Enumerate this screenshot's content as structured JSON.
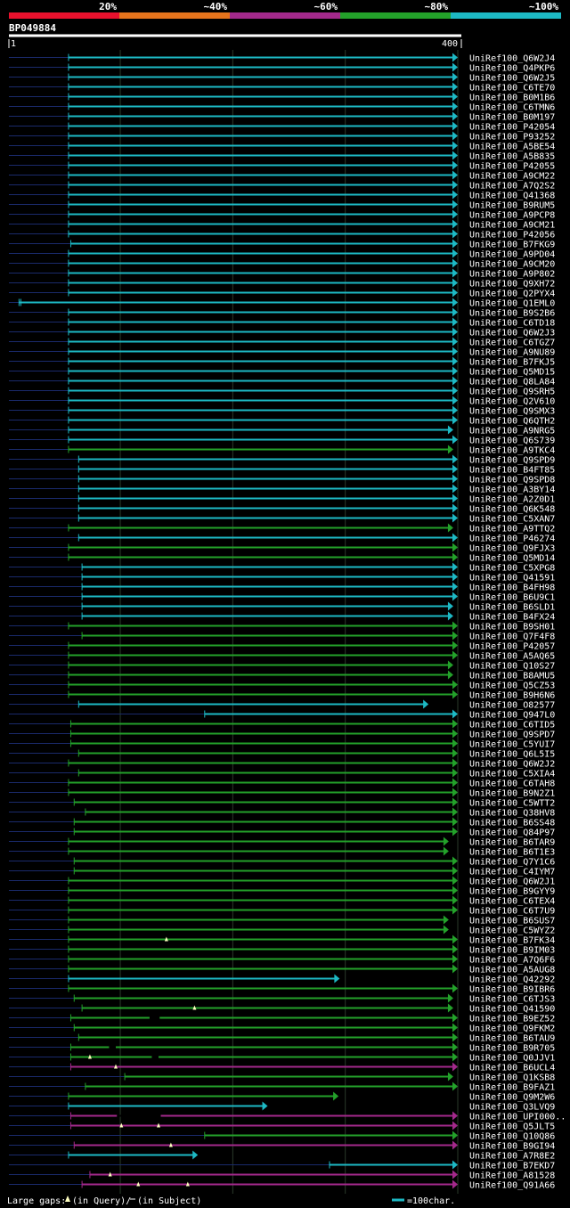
{
  "identity_bar": {
    "labels": [
      "20%",
      "~40%",
      "~60%",
      "~80%",
      "~100%"
    ],
    "colors": [
      "#e8112d",
      "#e6741c",
      "#a3298b",
      "#23a12a",
      "#1db9c4"
    ]
  },
  "query_id": "BP049884",
  "ruler": {
    "start": "1",
    "end": "400"
  },
  "legend": {
    "gaps_text": "Large gaps:",
    "query_text": "(in Query)/",
    "subject_text": "(in Subject)",
    "scale_text": "=100char."
  },
  "chart_data": {
    "type": "alignment",
    "query_length": 400,
    "xlim": [
      1,
      400
    ],
    "grid": true,
    "hits": [
      {
        "name": "UniRef100_Q6W2J4",
        "start": 54,
        "end": 400,
        "color": "cyan"
      },
      {
        "name": "UniRef100_Q4PKP6",
        "start": 54,
        "end": 400,
        "color": "cyan"
      },
      {
        "name": "UniRef100_Q6W2J5",
        "start": 54,
        "end": 400,
        "color": "cyan"
      },
      {
        "name": "UniRef100_C6TE70",
        "start": 54,
        "end": 400,
        "color": "cyan"
      },
      {
        "name": "UniRef100_B0M1B6",
        "start": 54,
        "end": 400,
        "color": "cyan"
      },
      {
        "name": "UniRef100_C6TMN6",
        "start": 54,
        "end": 400,
        "color": "cyan"
      },
      {
        "name": "UniRef100_B0M197",
        "start": 54,
        "end": 400,
        "color": "cyan"
      },
      {
        "name": "UniRef100_P42054",
        "start": 54,
        "end": 400,
        "color": "cyan"
      },
      {
        "name": "UniRef100_P93252",
        "start": 54,
        "end": 400,
        "color": "cyan"
      },
      {
        "name": "UniRef100_A5BE54",
        "start": 54,
        "end": 400,
        "color": "cyan"
      },
      {
        "name": "UniRef100_A5B835",
        "start": 54,
        "end": 400,
        "color": "cyan"
      },
      {
        "name": "UniRef100_P42055",
        "start": 54,
        "end": 400,
        "color": "cyan"
      },
      {
        "name": "UniRef100_A9CM22",
        "start": 54,
        "end": 400,
        "color": "cyan"
      },
      {
        "name": "UniRef100_A7Q2S2",
        "start": 54,
        "end": 400,
        "color": "cyan"
      },
      {
        "name": "UniRef100_Q41368",
        "start": 54,
        "end": 400,
        "color": "cyan"
      },
      {
        "name": "UniRef100_B9RUM5",
        "start": 54,
        "end": 400,
        "color": "cyan"
      },
      {
        "name": "UniRef100_A9PCP8",
        "start": 54,
        "end": 400,
        "color": "cyan"
      },
      {
        "name": "UniRef100_A9CM21",
        "start": 54,
        "end": 400,
        "color": "cyan"
      },
      {
        "name": "UniRef100_P42056",
        "start": 54,
        "end": 400,
        "color": "cyan"
      },
      {
        "name": "UniRef100_B7FKG9",
        "start": 56,
        "end": 400,
        "color": "cyan"
      },
      {
        "name": "UniRef100_A9PD04",
        "start": 54,
        "end": 400,
        "color": "cyan"
      },
      {
        "name": "UniRef100_A9CM20",
        "start": 54,
        "end": 400,
        "color": "cyan"
      },
      {
        "name": "UniRef100_A9P802",
        "start": 54,
        "end": 400,
        "color": "cyan"
      },
      {
        "name": "UniRef100_Q9XH72",
        "start": 54,
        "end": 400,
        "color": "cyan"
      },
      {
        "name": "UniRef100_Q2PYX4",
        "start": 54,
        "end": 400,
        "color": "cyan"
      },
      {
        "name": "UniRef100_Q1EML0",
        "start": 10,
        "end": 400,
        "color": "cyan",
        "extra": "start-cap"
      },
      {
        "name": "UniRef100_B9S2B6",
        "start": 54,
        "end": 400,
        "color": "cyan"
      },
      {
        "name": "UniRef100_C6TD18",
        "start": 54,
        "end": 400,
        "color": "cyan"
      },
      {
        "name": "UniRef100_Q6W2J3",
        "start": 54,
        "end": 400,
        "color": "cyan"
      },
      {
        "name": "UniRef100_C6TGZ7",
        "start": 54,
        "end": 400,
        "color": "cyan"
      },
      {
        "name": "UniRef100_A9NU89",
        "start": 54,
        "end": 400,
        "color": "cyan"
      },
      {
        "name": "UniRef100_B7FKJ5",
        "start": 54,
        "end": 400,
        "color": "cyan"
      },
      {
        "name": "UniRef100_Q5MD15",
        "start": 54,
        "end": 400,
        "color": "cyan"
      },
      {
        "name": "UniRef100_Q8LA84",
        "start": 54,
        "end": 400,
        "color": "cyan"
      },
      {
        "name": "UniRef100_Q9SRH5",
        "start": 54,
        "end": 400,
        "color": "cyan"
      },
      {
        "name": "UniRef100_Q2V610",
        "start": 54,
        "end": 400,
        "color": "cyan"
      },
      {
        "name": "UniRef100_Q9SMX3",
        "start": 54,
        "end": 400,
        "color": "cyan"
      },
      {
        "name": "UniRef100_Q6QTH2",
        "start": 54,
        "end": 400,
        "color": "cyan"
      },
      {
        "name": "UniRef100_A9NRG5",
        "start": 54,
        "end": 396,
        "color": "cyan"
      },
      {
        "name": "UniRef100_Q6S739",
        "start": 54,
        "end": 400,
        "color": "cyan"
      },
      {
        "name": "UniRef100_A9TKC4",
        "start": 54,
        "end": 396,
        "color": "green"
      },
      {
        "name": "UniRef100_Q9SPD9",
        "start": 63,
        "end": 400,
        "color": "cyan"
      },
      {
        "name": "UniRef100_B4FT85",
        "start": 63,
        "end": 400,
        "color": "cyan"
      },
      {
        "name": "UniRef100_Q9SPD8",
        "start": 63,
        "end": 400,
        "color": "cyan"
      },
      {
        "name": "UniRef100_A3BY14",
        "start": 63,
        "end": 400,
        "color": "cyan"
      },
      {
        "name": "UniRef100_A2Z0D1",
        "start": 63,
        "end": 400,
        "color": "cyan"
      },
      {
        "name": "UniRef100_Q6K548",
        "start": 63,
        "end": 400,
        "color": "cyan"
      },
      {
        "name": "UniRef100_C5XAN7",
        "start": 63,
        "end": 400,
        "color": "cyan"
      },
      {
        "name": "UniRef100_A9TTQ2",
        "start": 54,
        "end": 396,
        "color": "green"
      },
      {
        "name": "UniRef100_P46274",
        "start": 63,
        "end": 400,
        "color": "cyan"
      },
      {
        "name": "UniRef100_Q9FJX3",
        "start": 54,
        "end": 400,
        "color": "green"
      },
      {
        "name": "UniRef100_Q5MD14",
        "start": 54,
        "end": 400,
        "color": "green"
      },
      {
        "name": "UniRef100_C5XPG8",
        "start": 66,
        "end": 400,
        "color": "cyan"
      },
      {
        "name": "UniRef100_Q41591",
        "start": 66,
        "end": 400,
        "color": "cyan"
      },
      {
        "name": "UniRef100_B4FH98",
        "start": 66,
        "end": 400,
        "color": "cyan"
      },
      {
        "name": "UniRef100_B6U9C1",
        "start": 66,
        "end": 400,
        "color": "cyan"
      },
      {
        "name": "UniRef100_B6SLD1",
        "start": 66,
        "end": 396,
        "color": "cyan"
      },
      {
        "name": "UniRef100_B4FX24",
        "start": 66,
        "end": 396,
        "color": "cyan"
      },
      {
        "name": "UniRef100_B9SH01",
        "start": 54,
        "end": 400,
        "color": "green"
      },
      {
        "name": "UniRef100_Q7F4F8",
        "start": 66,
        "end": 400,
        "color": "green"
      },
      {
        "name": "UniRef100_P42057",
        "start": 54,
        "end": 400,
        "color": "green"
      },
      {
        "name": "UniRef100_A5AQ65",
        "start": 54,
        "end": 400,
        "color": "green"
      },
      {
        "name": "UniRef100_Q10S27",
        "start": 54,
        "end": 396,
        "color": "green"
      },
      {
        "name": "UniRef100_B8AMU5",
        "start": 54,
        "end": 396,
        "color": "green"
      },
      {
        "name": "UniRef100_Q5CZ53",
        "start": 54,
        "end": 400,
        "color": "green"
      },
      {
        "name": "UniRef100_B9H6N6",
        "start": 54,
        "end": 400,
        "color": "green"
      },
      {
        "name": "UniRef100_O82577",
        "start": 63,
        "end": 374,
        "color": "cyan"
      },
      {
        "name": "UniRef100_Q947L0",
        "start": 175,
        "end": 400,
        "color": "cyan"
      },
      {
        "name": "UniRef100_C6TID5",
        "start": 56,
        "end": 400,
        "color": "green"
      },
      {
        "name": "UniRef100_Q9SPD7",
        "start": 56,
        "end": 400,
        "color": "green"
      },
      {
        "name": "UniRef100_C5YUI7",
        "start": 56,
        "end": 400,
        "color": "green"
      },
      {
        "name": "UniRef100_Q6L5I5",
        "start": 63,
        "end": 400,
        "color": "green"
      },
      {
        "name": "UniRef100_Q6W2J2",
        "start": 54,
        "end": 400,
        "color": "green"
      },
      {
        "name": "UniRef100_C5XIA4",
        "start": 63,
        "end": 400,
        "color": "green"
      },
      {
        "name": "UniRef100_C6TAH8",
        "start": 54,
        "end": 400,
        "color": "green"
      },
      {
        "name": "UniRef100_B9N2Z1",
        "start": 54,
        "end": 400,
        "color": "green"
      },
      {
        "name": "UniRef100_C5WTT2",
        "start": 59,
        "end": 400,
        "color": "green"
      },
      {
        "name": "UniRef100_Q38HV8",
        "start": 69,
        "end": 400,
        "color": "green"
      },
      {
        "name": "UniRef100_B6SS48",
        "start": 59,
        "end": 400,
        "color": "green"
      },
      {
        "name": "UniRef100_Q84P97",
        "start": 59,
        "end": 400,
        "color": "green"
      },
      {
        "name": "UniRef100_B6TAR9",
        "start": 54,
        "end": 392,
        "color": "green"
      },
      {
        "name": "UniRef100_B6T1E3",
        "start": 54,
        "end": 392,
        "color": "green"
      },
      {
        "name": "UniRef100_Q7Y1C6",
        "start": 59,
        "end": 400,
        "color": "green"
      },
      {
        "name": "UniRef100_C4IYM7",
        "start": 59,
        "end": 400,
        "color": "green"
      },
      {
        "name": "UniRef100_Q6W2J1",
        "start": 54,
        "end": 400,
        "color": "green"
      },
      {
        "name": "UniRef100_B9GYY9",
        "start": 54,
        "end": 400,
        "color": "green"
      },
      {
        "name": "UniRef100_C6TEX4",
        "start": 54,
        "end": 400,
        "color": "green"
      },
      {
        "name": "UniRef100_C6T7U9",
        "start": 54,
        "end": 400,
        "color": "green"
      },
      {
        "name": "UniRef100_B6SUS7",
        "start": 54,
        "end": 392,
        "color": "green"
      },
      {
        "name": "UniRef100_C5WYZ2",
        "start": 54,
        "end": 392,
        "color": "green"
      },
      {
        "name": "UniRef100_B7FK34",
        "start": 54,
        "end": 400,
        "color": "green",
        "gaps": [
          {
            "pos": 141,
            "in": "query"
          }
        ]
      },
      {
        "name": "UniRef100_B9IM03",
        "start": 54,
        "end": 400,
        "color": "green"
      },
      {
        "name": "UniRef100_A7Q6F6",
        "start": 54,
        "end": 400,
        "color": "green"
      },
      {
        "name": "UniRef100_A5AUG8",
        "start": 54,
        "end": 400,
        "color": "green"
      },
      {
        "name": "UniRef100_Q42292",
        "start": 54,
        "end": 295,
        "color": "cyan"
      },
      {
        "name": "UniRef100_B9IBR6",
        "start": 54,
        "end": 400,
        "color": "green"
      },
      {
        "name": "UniRef100_C6TJS3",
        "start": 59,
        "end": 396,
        "color": "green"
      },
      {
        "name": "UniRef100_Q41590",
        "start": 66,
        "end": 396,
        "color": "green",
        "gaps": [
          {
            "pos": 166,
            "in": "query"
          }
        ]
      },
      {
        "name": "UniRef100_B9EZ52",
        "start": 56,
        "end": 400,
        "color": "green",
        "gaps": [
          {
            "pos": 126,
            "in": "subject",
            "end": 135
          }
        ]
      },
      {
        "name": "UniRef100_Q9FKM2",
        "start": 59,
        "end": 400,
        "color": "green"
      },
      {
        "name": "UniRef100_B6TAU9",
        "start": 63,
        "end": 400,
        "color": "green"
      },
      {
        "name": "UniRef100_B9R705",
        "start": 56,
        "end": 400,
        "color": "green",
        "gaps": [
          {
            "pos": 90,
            "in": "subject",
            "end": 96
          }
        ]
      },
      {
        "name": "UniRef100_Q0JJV1",
        "start": 56,
        "end": 400,
        "color": "green",
        "gaps": [
          {
            "pos": 73,
            "in": "query"
          },
          {
            "pos": 128,
            "in": "subject",
            "end": 134
          }
        ]
      },
      {
        "name": "UniRef100_B6UCL4",
        "start": 56,
        "end": 400,
        "color": "magenta",
        "gaps": [
          {
            "pos": 96,
            "in": "query"
          }
        ]
      },
      {
        "name": "UniRef100_Q1KSB8",
        "start": 104,
        "end": 396,
        "color": "green"
      },
      {
        "name": "UniRef100_B9FAZ1",
        "start": 69,
        "end": 400,
        "color": "green"
      },
      {
        "name": "UniRef100_Q9M2W6",
        "start": 54,
        "end": 294,
        "color": "green"
      },
      {
        "name": "UniRef100_Q3LVQ9",
        "start": 54,
        "end": 231,
        "color": "cyan"
      },
      {
        "name": "UniRef100_UPI000..",
        "start": 56,
        "end": 400,
        "color": "magenta",
        "gaps": [
          {
            "pos": 97,
            "in": "subject",
            "end": 136
          }
        ]
      },
      {
        "name": "UniRef100_Q5JLT5",
        "start": 56,
        "end": 400,
        "color": "magenta",
        "gaps": [
          {
            "pos": 101,
            "in": "query"
          },
          {
            "pos": 134,
            "in": "query"
          }
        ]
      },
      {
        "name": "UniRef100_Q10Q86",
        "start": 175,
        "end": 400,
        "color": "green"
      },
      {
        "name": "UniRef100_B9GI94",
        "start": 59,
        "end": 400,
        "color": "magenta",
        "gaps": [
          {
            "pos": 145,
            "in": "query"
          }
        ]
      },
      {
        "name": "UniRef100_A7R8E2",
        "start": 54,
        "end": 169,
        "color": "cyan"
      },
      {
        "name": "UniRef100_B7EKD7",
        "start": 286,
        "end": 400,
        "color": "cyan"
      },
      {
        "name": "UniRef100_A81528",
        "start": 73,
        "end": 400,
        "color": "magenta",
        "gaps": [
          {
            "pos": 91,
            "in": "query"
          }
        ]
      },
      {
        "name": "UniRef100_Q91A66",
        "start": 66,
        "end": 400,
        "color": "magenta",
        "gaps": [
          {
            "pos": 116,
            "in": "query"
          },
          {
            "pos": 160,
            "in": "query"
          }
        ]
      }
    ],
    "colors": {
      "cyan": "#1db9c4",
      "green": "#23a12a",
      "magenta": "#a3298b",
      "navy": "#1a2a6b",
      "grid": "#2a3a2a",
      "gap_marker": "#ffffc0"
    }
  }
}
